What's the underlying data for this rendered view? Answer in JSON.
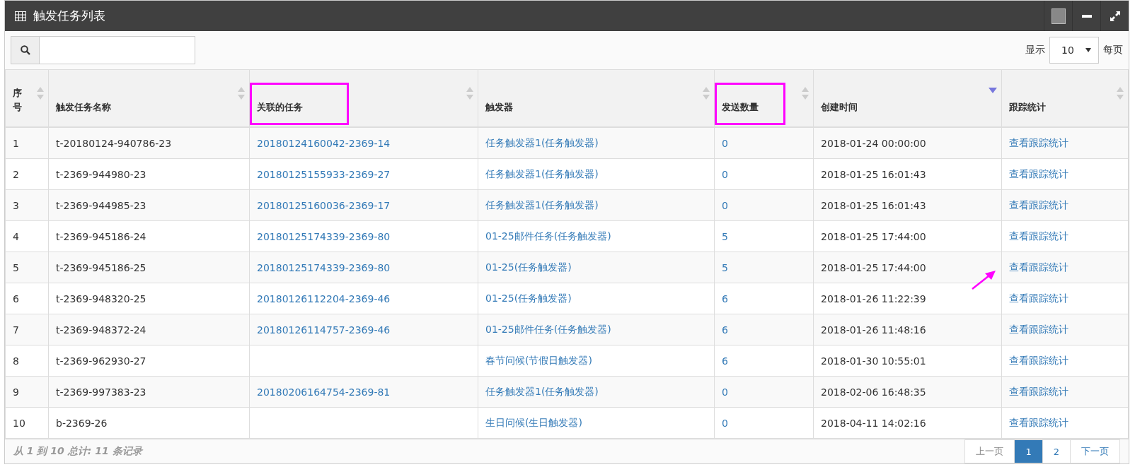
{
  "panel": {
    "title": "触发任务列表"
  },
  "page_size": {
    "label_before": "显示",
    "value": "10",
    "label_after": "每页"
  },
  "table": {
    "columns": [
      {
        "label": "序号",
        "kind": "text",
        "sorted": false,
        "highlighted": false
      },
      {
        "label": "触发任务名称",
        "kind": "text",
        "sorted": false,
        "highlighted": false
      },
      {
        "label": "关联的任务",
        "kind": "link",
        "sorted": false,
        "highlighted": true
      },
      {
        "label": "触发器",
        "kind": "link",
        "sorted": false,
        "highlighted": false
      },
      {
        "label": "发送数量",
        "kind": "link",
        "sorted": false,
        "highlighted": true
      },
      {
        "label": "创建时间",
        "kind": "text",
        "sorted": true,
        "highlighted": false
      },
      {
        "label": "跟踪统计",
        "kind": "link",
        "sorted": false,
        "highlighted": false
      }
    ],
    "rows": [
      {
        "pointed": false,
        "cells": [
          "1",
          "t-20180124-940786-23",
          "20180124160042-2369-14",
          "任务触发器1(任务触发器)",
          "0",
          "2018-01-24 00:00:00",
          "查看跟踪统计"
        ]
      },
      {
        "pointed": false,
        "cells": [
          "2",
          "t-2369-944980-23",
          "20180125155933-2369-27",
          "任务触发器1(任务触发器)",
          "0",
          "2018-01-25 16:01:43",
          "查看跟踪统计"
        ]
      },
      {
        "pointed": false,
        "cells": [
          "3",
          "t-2369-944985-23",
          "20180125160036-2369-17",
          "任务触发器1(任务触发器)",
          "0",
          "2018-01-25 16:01:43",
          "查看跟踪统计"
        ]
      },
      {
        "pointed": false,
        "cells": [
          "4",
          "t-2369-945186-24",
          "20180125174339-2369-80",
          "01-25邮件任务(任务触发器)",
          "5",
          "2018-01-25 17:44:00",
          "查看跟踪统计"
        ]
      },
      {
        "pointed": true,
        "cells": [
          "5",
          "t-2369-945186-25",
          "20180125174339-2369-80",
          "01-25(任务触发器)",
          "5",
          "2018-01-25 17:44:00",
          "查看跟踪统计"
        ]
      },
      {
        "pointed": false,
        "cells": [
          "6",
          "t-2369-948320-25",
          "20180126112204-2369-46",
          "01-25(任务触发器)",
          "6",
          "2018-01-26 11:22:39",
          "查看跟踪统计"
        ]
      },
      {
        "pointed": false,
        "cells": [
          "7",
          "t-2369-948372-24",
          "20180126114757-2369-46",
          "01-25邮件任务(任务触发器)",
          "6",
          "2018-01-26 11:48:16",
          "查看跟踪统计"
        ]
      },
      {
        "pointed": false,
        "cells": [
          "8",
          "t-2369-962930-27",
          "",
          "春节问候(节假日触发器)",
          "6",
          "2018-01-30 10:55:01",
          "查看跟踪统计"
        ]
      },
      {
        "pointed": false,
        "cells": [
          "9",
          "t-2369-997383-23",
          "20180206164754-2369-81",
          "任务触发器1(任务触发器)",
          "0",
          "2018-02-06 16:48:35",
          "查看跟踪统计"
        ]
      },
      {
        "pointed": false,
        "cells": [
          "10",
          "b-2369-26",
          "",
          "生日问候(生日触发器)",
          "0",
          "2018-04-11 14:02:16",
          "查看跟踪统计"
        ]
      }
    ]
  },
  "footer": {
    "summary": "从 1 到 10 总计: 11 条记录"
  },
  "pagination": [
    {
      "label": "上一页",
      "selected": false,
      "disabled": true
    },
    {
      "label": "1",
      "selected": true,
      "disabled": false
    },
    {
      "label": "2",
      "selected": false,
      "disabled": false
    },
    {
      "label": "下一页",
      "selected": false,
      "disabled": false
    }
  ]
}
